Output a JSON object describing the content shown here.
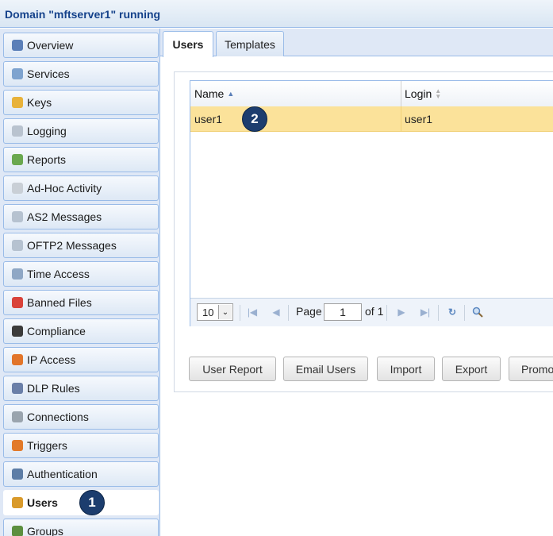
{
  "window": {
    "title": "Domain \"mftserver1\" running"
  },
  "sidebar": {
    "items": [
      {
        "label": "Overview",
        "icon": "overview-icon",
        "color": "#5b7fb8"
      },
      {
        "label": "Services",
        "icon": "services-icon",
        "color": "#7ea3cf"
      },
      {
        "label": "Keys",
        "icon": "keys-icon",
        "color": "#e8b23a"
      },
      {
        "label": "Logging",
        "icon": "logging-icon",
        "color": "#b9c3cf"
      },
      {
        "label": "Reports",
        "icon": "reports-icon",
        "color": "#6aa84f"
      },
      {
        "label": "Ad-Hoc Activity",
        "icon": "envelope-icon",
        "color": "#c9cfd6"
      },
      {
        "label": "AS2 Messages",
        "icon": "as2-icon",
        "color": "#b6c2d0"
      },
      {
        "label": "OFTP2 Messages",
        "icon": "oftp2-icon",
        "color": "#b6c2d0"
      },
      {
        "label": "Time Access",
        "icon": "time-access-icon",
        "color": "#8fa7c5"
      },
      {
        "label": "Banned Files",
        "icon": "banned-icon",
        "color": "#d9433a"
      },
      {
        "label": "Compliance",
        "icon": "compliance-icon",
        "color": "#3b3b3b"
      },
      {
        "label": "IP Access",
        "icon": "ip-access-icon",
        "color": "#e2752a"
      },
      {
        "label": "DLP Rules",
        "icon": "shield-icon",
        "color": "#6a7fa8"
      },
      {
        "label": "Connections",
        "icon": "connections-icon",
        "color": "#9aa4ae"
      },
      {
        "label": "Triggers",
        "icon": "triggers-icon",
        "color": "#e27a2a"
      },
      {
        "label": "Authentication",
        "icon": "authentication-icon",
        "color": "#5d7da6"
      },
      {
        "label": "Users",
        "icon": "user-icon",
        "color": "#d99a2b"
      },
      {
        "label": "Groups",
        "icon": "groups-icon",
        "color": "#5c8f3f"
      }
    ],
    "active_index": 16
  },
  "markers": {
    "first": "1",
    "second": "2"
  },
  "tabs": [
    {
      "label": "Users"
    },
    {
      "label": "Templates"
    }
  ],
  "grid": {
    "columns": [
      {
        "label": "Name",
        "sort": "asc"
      },
      {
        "label": "Login",
        "sort": "none"
      }
    ],
    "rows": [
      {
        "name": "user1",
        "login": "user1"
      }
    ]
  },
  "pager": {
    "page_size": "10",
    "page_label": "Page",
    "page": "1",
    "of_label": "of 1"
  },
  "actions": {
    "user_report": "User Report",
    "email_users": "Email Users",
    "import": "Import",
    "export": "Export",
    "promote": "Promo"
  }
}
